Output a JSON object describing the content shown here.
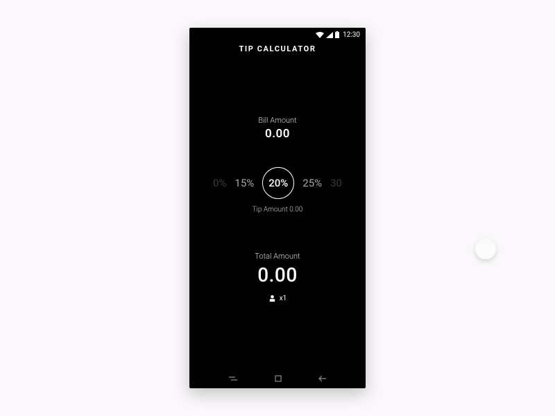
{
  "statusbar": {
    "time": "12:30"
  },
  "app": {
    "title": "TIP CALCULATOR"
  },
  "bill": {
    "label": "Bill Amount",
    "value": "0.00"
  },
  "tips": {
    "options": [
      "0%",
      "15%",
      "20%",
      "25%",
      "30"
    ],
    "selected": "20%",
    "amount_label": "Tip Amount",
    "amount_value": "0.00"
  },
  "total": {
    "label": "Total Amount",
    "value": "0.00"
  },
  "split": {
    "prefix": "x",
    "count": "1"
  }
}
